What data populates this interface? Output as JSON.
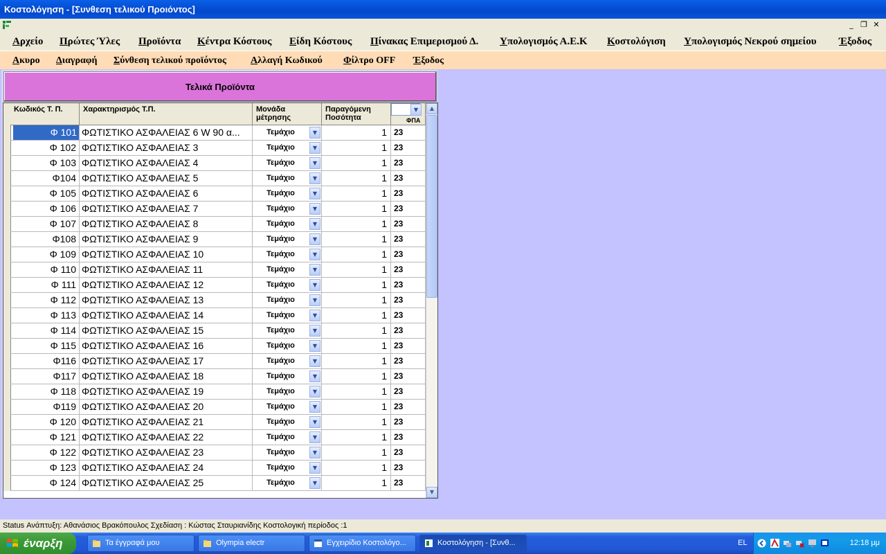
{
  "window": {
    "title": "Κοστολόγηση - [Συνθεση τελικού Προιόντος]"
  },
  "menu": [
    "Αρχείο",
    "Πρώτες Ύλες",
    "Προϊόντα",
    "Κέντρα Κόστους",
    "Είδη Κόστους",
    "Πίνακας Επιμερισμού Δ.",
    "Υπολογισμός Α.Ε.Κ",
    "Κοστολόγιση",
    "Υπολογισμός Νεκρού σημείου",
    "Έξοδος"
  ],
  "toolbar": [
    "Ακυρο",
    "Διαγραφή",
    "Σύνθεση τελικού προϊόντος",
    "Αλλαγή Κωδικού",
    "Φίλτρο OFF",
    "Έξοδος"
  ],
  "panel": {
    "title": "Τελικά Προϊόντα"
  },
  "grid": {
    "columns": [
      "Κωδικός Τ. Π.",
      "Χαρακτηρισμός Τ.Π.",
      "Μονάδα μέτρησης",
      "Παραγόμενη Ποσότητα",
      "ΦΠΑ"
    ],
    "rows": [
      {
        "code": "Φ 101",
        "desc": "ΦΩΤΙΣΤΙΚΟ ΑΣΦΑΛΕΙΑΣ  6 W 90 α...",
        "unit": "Τεμάχιο",
        "qty": "1",
        "vat": "23"
      },
      {
        "code": "Φ 102",
        "desc": "ΦΩΤΙΣΤΙΚΟ ΑΣΦΑΛΕΙΑΣ 3",
        "unit": "Τεμάχιο",
        "qty": "1",
        "vat": "23"
      },
      {
        "code": "Φ 103",
        "desc": "ΦΩΤΙΣΤΙΚΟ ΑΣΦΑΛΕΙΑΣ 4",
        "unit": "Τεμάχιο",
        "qty": "1",
        "vat": "23"
      },
      {
        "code": "Φ104",
        "desc": "ΦΩΤΙΣΤΙΚΟ ΑΣΦΑΛΕΙΑΣ 5",
        "unit": "Τεμάχιο",
        "qty": "1",
        "vat": "23"
      },
      {
        "code": "Φ 105",
        "desc": "ΦΩΤΙΣΤΙΚΟ ΑΣΦΑΛΕΙΑΣ 6",
        "unit": "Τεμάχιο",
        "qty": "1",
        "vat": "23"
      },
      {
        "code": "Φ 106",
        "desc": "ΦΩΤΙΣΤΙΚΟ ΑΣΦΑΛΕΙΑΣ 7",
        "unit": "Τεμάχιο",
        "qty": "1",
        "vat": "23"
      },
      {
        "code": "Φ 107",
        "desc": "ΦΩΤΙΣΤΙΚΟ ΑΣΦΑΛΕΙΑΣ 8",
        "unit": "Τεμάχιο",
        "qty": "1",
        "vat": "23"
      },
      {
        "code": "Φ108",
        "desc": "ΦΩΤΙΣΤΙΚΟ ΑΣΦΑΛΕΙΑΣ 9",
        "unit": "Τεμάχιο",
        "qty": "1",
        "vat": "23"
      },
      {
        "code": "Φ 109",
        "desc": "ΦΩΤΙΣΤΙΚΟ ΑΣΦΑΛΕΙΑΣ 10",
        "unit": "Τεμάχιο",
        "qty": "1",
        "vat": "23"
      },
      {
        "code": "Φ 110",
        "desc": "ΦΩΤΙΣΤΙΚΟ ΑΣΦΑΛΕΙΑΣ 11",
        "unit": "Τεμάχιο",
        "qty": "1",
        "vat": "23"
      },
      {
        "code": "Φ 111",
        "desc": "ΦΩΤΙΣΤΙΚΟ ΑΣΦΑΛΕΙΑΣ 12",
        "unit": "Τεμάχιο",
        "qty": "1",
        "vat": "23"
      },
      {
        "code": "Φ 112",
        "desc": "ΦΩΤΙΣΤΙΚΟ ΑΣΦΑΛΕΙΑΣ 13",
        "unit": "Τεμάχιο",
        "qty": "1",
        "vat": "23"
      },
      {
        "code": "Φ 113",
        "desc": "ΦΩΤΙΣΤΙΚΟ ΑΣΦΑΛΕΙΑΣ 14",
        "unit": "Τεμάχιο",
        "qty": "1",
        "vat": "23"
      },
      {
        "code": "Φ 114",
        "desc": "ΦΩΤΙΣΤΙΚΟ ΑΣΦΑΛΕΙΑΣ 15",
        "unit": "Τεμάχιο",
        "qty": "1",
        "vat": "23"
      },
      {
        "code": "Φ 115",
        "desc": "ΦΩΤΙΣΤΙΚΟ ΑΣΦΑΛΕΙΑΣ 16",
        "unit": "Τεμάχιο",
        "qty": "1",
        "vat": "23"
      },
      {
        "code": "Φ116",
        "desc": "ΦΩΤΙΣΤΙΚΟ ΑΣΦΑΛΕΙΑΣ 17",
        "unit": "Τεμάχιο",
        "qty": "1",
        "vat": "23"
      },
      {
        "code": "Φ117",
        "desc": "ΦΩΤΙΣΤΙΚΟ ΑΣΦΑΛΕΙΑΣ 18",
        "unit": "Τεμάχιο",
        "qty": "1",
        "vat": "23"
      },
      {
        "code": "Φ 118",
        "desc": "ΦΩΤΙΣΤΙΚΟ ΑΣΦΑΛΕΙΑΣ 19",
        "unit": "Τεμάχιο",
        "qty": "1",
        "vat": "23"
      },
      {
        "code": "Φ119",
        "desc": "ΦΩΤΙΣΤΙΚΟ ΑΣΦΑΛΕΙΑΣ 20",
        "unit": "Τεμάχιο",
        "qty": "1",
        "vat": "23"
      },
      {
        "code": "Φ 120",
        "desc": "ΦΩΤΙΣΤΙΚΟ ΑΣΦΑΛΕΙΑΣ 21",
        "unit": "Τεμάχιο",
        "qty": "1",
        "vat": "23"
      },
      {
        "code": "Φ 121",
        "desc": "ΦΩΤΙΣΤΙΚΟ ΑΣΦΑΛΕΙΑΣ 22",
        "unit": "Τεμάχιο",
        "qty": "1",
        "vat": "23"
      },
      {
        "code": "Φ 122",
        "desc": "ΦΩΤΙΣΤΙΚΟ ΑΣΦΑΛΕΙΑΣ 23",
        "unit": "Τεμάχιο",
        "qty": "1",
        "vat": "23"
      },
      {
        "code": "Φ 123",
        "desc": "ΦΩΤΙΣΤΙΚΟ ΑΣΦΑΛΕΙΑΣ 24",
        "unit": "Τεμάχιο",
        "qty": "1",
        "vat": "23"
      },
      {
        "code": "Φ 124",
        "desc": "ΦΩΤΙΣΤΙΚΟ ΑΣΦΑΛΕΙΑΣ 25",
        "unit": "Τεμάχιο",
        "qty": "1",
        "vat": "23"
      }
    ],
    "selected_row": 0
  },
  "status": "Status  Ανάπτυξη: Αθανάσιος Βρακόπουλος  Σχεδίαση : Κώστας Σταυριανίδης  Κοστολογική περίοδος :1",
  "taskbar": {
    "start": "έναρξη",
    "tasks": [
      "Τα έγγραφά μου",
      "Olympia electr",
      "Εγχειρίδιο Κοστολόγο...",
      "Κοστολόγηση - [Συνθ..."
    ],
    "lang": "EL",
    "time": "12:18 μμ"
  },
  "colors": {
    "menubar": "#ece9d8",
    "toolbar": "#ffdcb6",
    "banner": "#db74da",
    "desktop": "#c4c2ff",
    "selection": "#3169c6"
  }
}
